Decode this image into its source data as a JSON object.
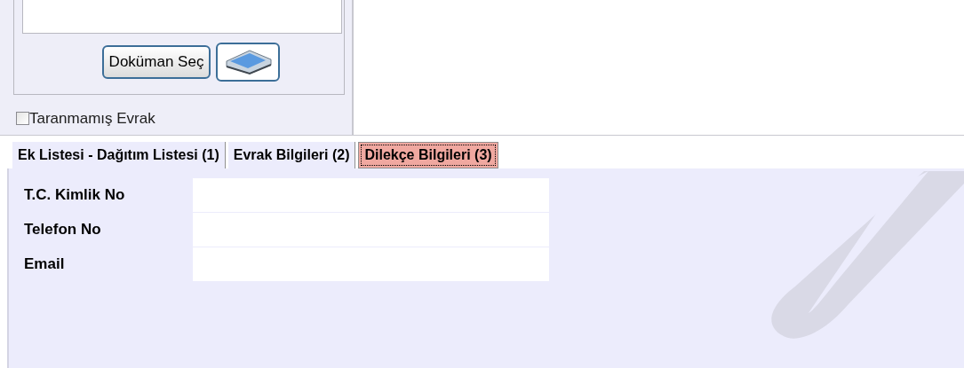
{
  "document_panel": {
    "select_button": "Doküman Seç",
    "unscanned_checkbox": {
      "label": "Taranmamış Evrak",
      "checked": false
    }
  },
  "tabs": [
    {
      "label": "Ek Listesi - Dağıtım Listesi (1)",
      "selected": false
    },
    {
      "label": "Evrak Bilgileri (2)",
      "selected": false
    },
    {
      "label": "Dilekçe Bilgileri (3)",
      "selected": true
    }
  ],
  "form": [
    {
      "label": "T.C. Kimlik No"
    },
    {
      "label": "Telefon No"
    },
    {
      "label": "Email"
    }
  ]
}
